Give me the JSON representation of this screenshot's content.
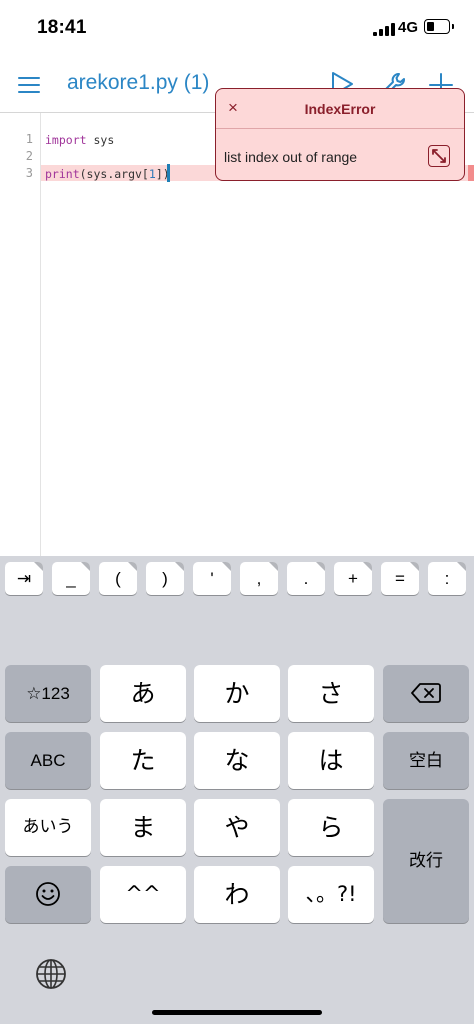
{
  "status_bar": {
    "time": "18:41",
    "network": "4G",
    "battery_level": 0.35
  },
  "nav": {
    "title": "arekore1.py (1)",
    "menu_icon": "hamburger-menu-icon",
    "run_icon": "play-icon",
    "tools_icon": "wrench-icon",
    "add_icon": "plus-icon",
    "accent": "#2b86c5"
  },
  "editor": {
    "line_numbers": [
      "1",
      "2",
      "3"
    ],
    "line1": {
      "keyword": "import",
      "rest": " sys"
    },
    "line2": "",
    "line3": {
      "keyword": "print",
      "p1": "(sys.argv[",
      "num": "1",
      "p2": "])"
    },
    "error_line": 3
  },
  "error_popup": {
    "close_label": "×",
    "title": "IndexError",
    "message": "list index out of range",
    "color": "#8a1f2b",
    "background": "#fdd8d8"
  },
  "accessory_keys": [
    "⇥",
    "_",
    "(",
    ")",
    "'",
    ",",
    ".",
    "+",
    "=",
    ":"
  ],
  "keyboard": {
    "row1": {
      "fn_left": "☆123",
      "k1": "あ",
      "k2": "か",
      "k3": "さ",
      "fn_right_icon": "backspace-icon"
    },
    "row2": {
      "fn_left": "ABC",
      "k1": "た",
      "k2": "な",
      "k3": "は",
      "fn_right": "空白"
    },
    "row3": {
      "fn_left": "あいう",
      "k1": "ま",
      "k2": "や",
      "k3": "ら",
      "fn_right": "改行"
    },
    "row4": {
      "fn_left_icon": "emoji-icon",
      "k1": "^^",
      "k2": "わ",
      "k3": "、。?!"
    },
    "globe_icon": "globe-icon"
  }
}
